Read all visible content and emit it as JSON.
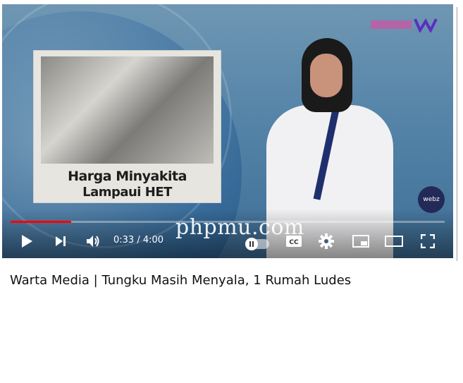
{
  "video": {
    "clipping_headline_line1": "Harga Minyakita",
    "clipping_headline_line2": "Lampaui HET",
    "badge_label": "webz",
    "progress_fraction": 0.14
  },
  "controls": {
    "time_display": "0:33 / 4:00",
    "icons": [
      "play-icon",
      "next-icon",
      "volume-icon",
      "autoplay-toggle-icon",
      "captions-icon",
      "settings-icon",
      "miniplayer-icon",
      "theater-mode-icon",
      "fullscreen-icon"
    ],
    "accent_color": "#ff0000"
  },
  "watermark": "phpmu.com",
  "video_title": "Warta Media | Tungku Masih Menyala, 1 Rumah Ludes"
}
